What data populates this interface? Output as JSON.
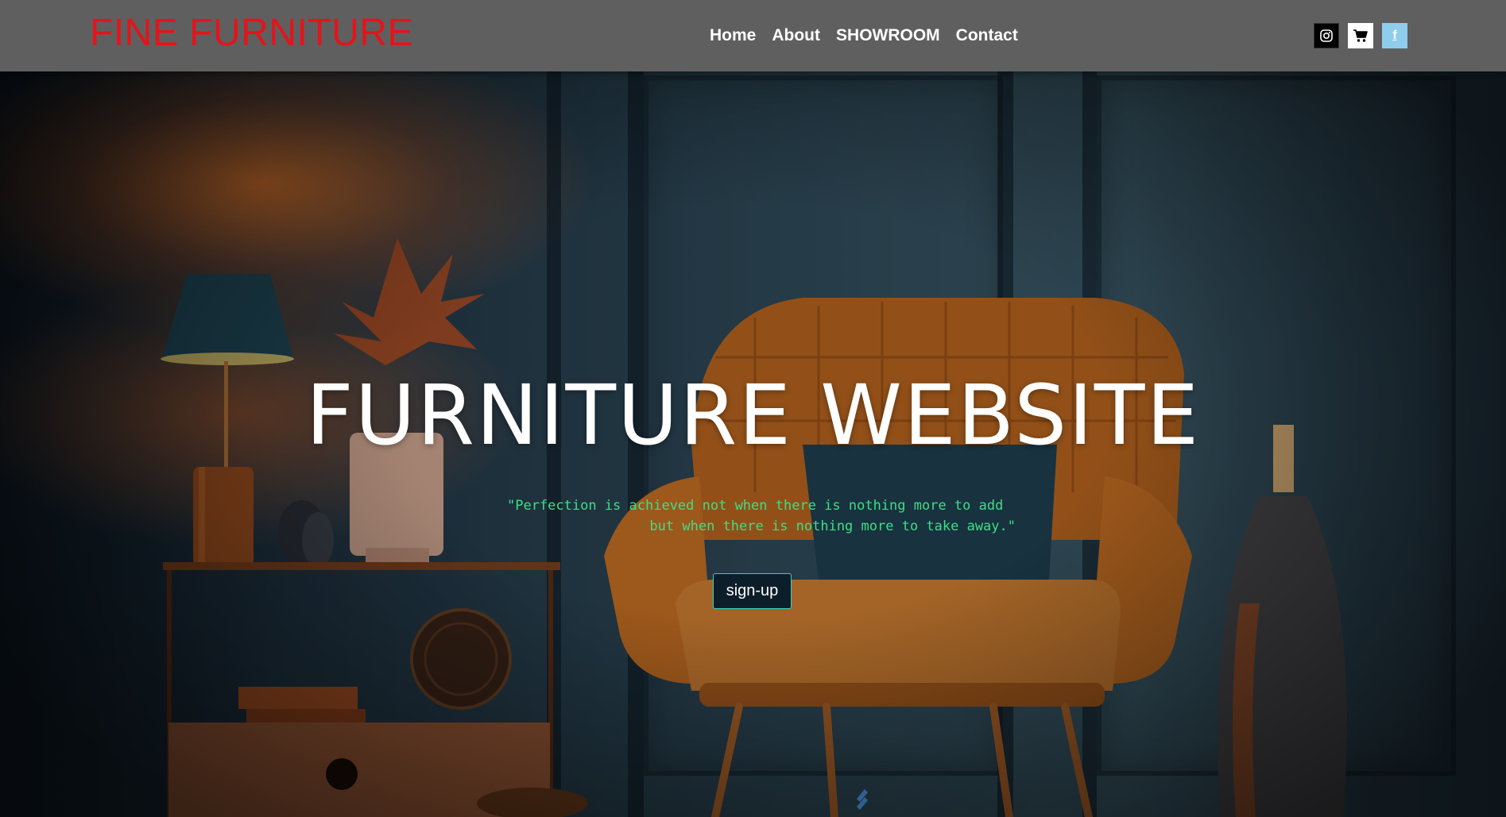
{
  "header": {
    "brand": "FINE FURNITURE",
    "nav": [
      {
        "label": "Home"
      },
      {
        "label": "About"
      },
      {
        "label": "SHOWROOM"
      },
      {
        "label": "Contact"
      }
    ],
    "social": [
      {
        "icon": "instagram-icon"
      },
      {
        "icon": "shopping-cart-icon"
      },
      {
        "icon": "facebook-icon",
        "glyph": "f"
      }
    ]
  },
  "hero": {
    "title": "FURNITURE WEBSITE",
    "quote_line1": "\"Perfection is achieved not when there is nothing more to add",
    "quote_line2": "but when there is nothing more to take away.\"",
    "signup_label": "sign-up"
  },
  "colors": {
    "brand": "#e3141b",
    "navbar": "#5f5f5f",
    "quote": "#3ddf86",
    "signup_border": "#2fd4c1",
    "facebook": "#8fcdec"
  }
}
